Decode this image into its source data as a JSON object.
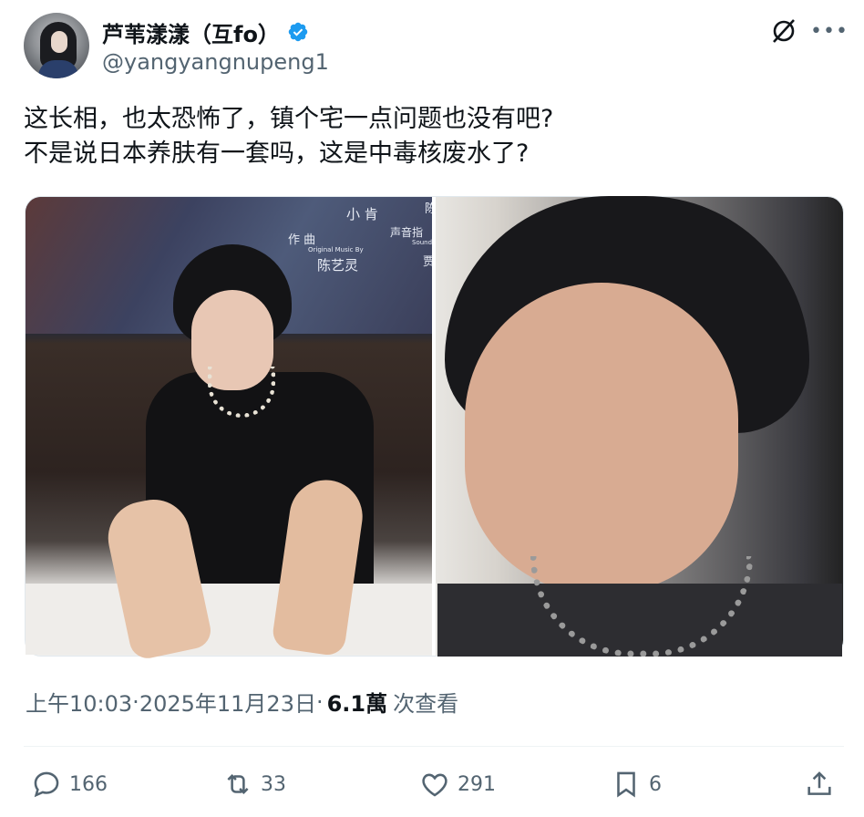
{
  "author": {
    "display_name": "芦苇漾漾（互fo）",
    "handle": "@yangyangnupeng1",
    "verified": true
  },
  "tweet": {
    "lines": [
      "这长相，也太恐怖了，镇个宅一点问题也没有吧?",
      "不是说日本养肤有一套吗，这是中毒核废水了?"
    ]
  },
  "media": {
    "left_photo_screen_text": [
      "小 肯",
      "作 曲",
      "Original Music By",
      "陈艺灵",
      "声音指",
      "Sound",
      "陈",
      "贾"
    ]
  },
  "meta": {
    "time": "上午10:03",
    "separator1": " · ",
    "date": "2025年11月23日",
    "separator2": " · ",
    "views_count": "6.1萬",
    "views_label": "次查看"
  },
  "actions": {
    "reply_count": "166",
    "retweet_count": "33",
    "like_count": "291",
    "bookmark_count": "6"
  },
  "colors": {
    "verified_blue": "#1d9bf0",
    "secondary_text": "#536471",
    "primary_text": "#0f1419"
  },
  "icons": [
    "verified-icon",
    "grok-icon",
    "more-icon",
    "reply-icon",
    "retweet-icon",
    "like-icon",
    "bookmark-icon",
    "share-icon"
  ]
}
